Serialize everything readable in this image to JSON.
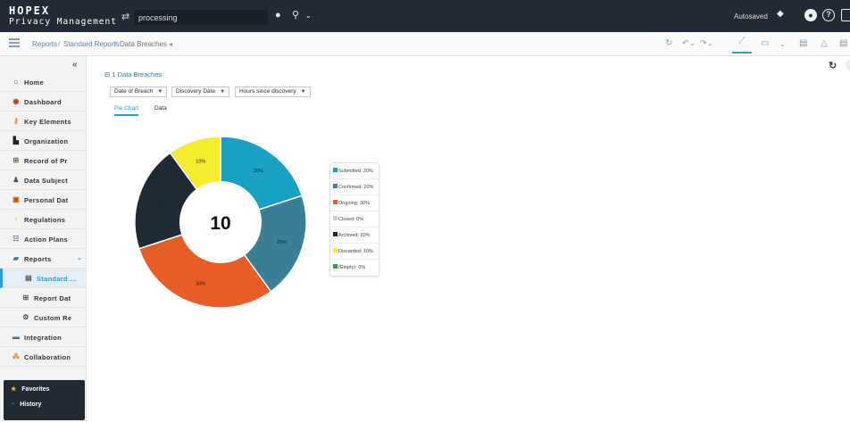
{
  "app": {
    "brand_top": "HOPEX",
    "brand_bottom": "Privacy Management",
    "search_value": "processing",
    "autosaved": "Autosaved"
  },
  "breadcrumb": {
    "items": [
      "Reports",
      "Standard Reports",
      "Data Breaches"
    ],
    "sep": "/"
  },
  "sidebar": {
    "items": [
      {
        "label": "Home",
        "icon": "home-icon"
      },
      {
        "label": "Dashboard",
        "icon": "dashboard-icon"
      },
      {
        "label": "Key Elements",
        "icon": "key-elements-icon"
      },
      {
        "label": "Organization",
        "icon": "organization-icon"
      },
      {
        "label": "Record of Pr",
        "icon": "record-icon"
      },
      {
        "label": "Data Subject",
        "icon": "data-subject-icon"
      },
      {
        "label": "Personal Dat",
        "icon": "personal-data-icon"
      },
      {
        "label": "Regulations",
        "icon": "regulations-icon"
      },
      {
        "label": "Action Plans",
        "icon": "action-plans-icon"
      },
      {
        "label": "Reports",
        "icon": "reports-icon"
      },
      {
        "label": "Standard ...",
        "icon": "standard-reports-icon"
      },
      {
        "label": "Report Dat",
        "icon": "report-data-icon"
      },
      {
        "label": "Custom Re",
        "icon": "custom-reports-icon"
      },
      {
        "label": "Integration",
        "icon": "integration-icon"
      },
      {
        "label": "Collaboration",
        "icon": "collaboration-icon"
      }
    ],
    "favorites": "Favorites",
    "history": "History"
  },
  "report": {
    "title": "Data Breaches",
    "filters": [
      "Date of Breach",
      "Discovery Date",
      "Hours since discovery"
    ],
    "tabs": [
      "Pie Chart",
      "Data"
    ],
    "active_tab": "Pie Chart"
  },
  "chart_data": {
    "type": "pie",
    "center_label": "10",
    "slices": [
      {
        "name": "Submitted",
        "value": 20,
        "color": "#17a2c4"
      },
      {
        "name": "Confirmed",
        "value": 20,
        "color": "#3a7f95"
      },
      {
        "name": "Ongoing",
        "value": 30,
        "color": "#e85c26"
      },
      {
        "name": "Closed",
        "value": 0,
        "color": "#c9d1dc"
      },
      {
        "name": "Archived",
        "value": 20,
        "color": "#202a35"
      },
      {
        "name": "Discarded",
        "value": 10,
        "color": "#f5ed2b"
      },
      {
        "name": "(Empty)",
        "value": 0,
        "color": "#3f9a3f"
      }
    ],
    "slice_labels": [
      "20%",
      "20%",
      "30%",
      "20%",
      "10%"
    ],
    "legend_labels": [
      "Submitted: 20%",
      "Confirmed: 20%",
      "Ongoing: 30%",
      "Closed: 0%",
      "Archived: 20%",
      "Discarded: 10%",
      "(Empty): 0%"
    ]
  }
}
